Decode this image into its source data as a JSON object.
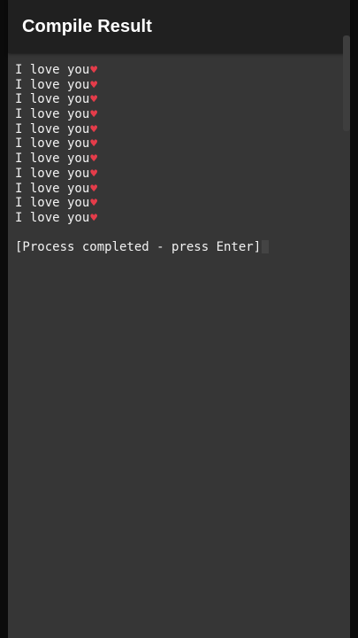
{
  "app_bar": {
    "title": "Compile Result"
  },
  "terminal": {
    "output_lines": [
      "I love you",
      "I love you",
      "I love you",
      "I love you",
      "I love you",
      "I love you",
      "I love you",
      "I love you",
      "I love you",
      "I love you",
      "I love you"
    ],
    "line_suffix_icon": "red-heart-icon",
    "status_text": "[Process completed - press Enter]"
  },
  "colors": {
    "app_bar_bg": "#202020",
    "terminal_bg": "#363636",
    "text": "#f2f2f2",
    "heart": "#e53c4a"
  }
}
